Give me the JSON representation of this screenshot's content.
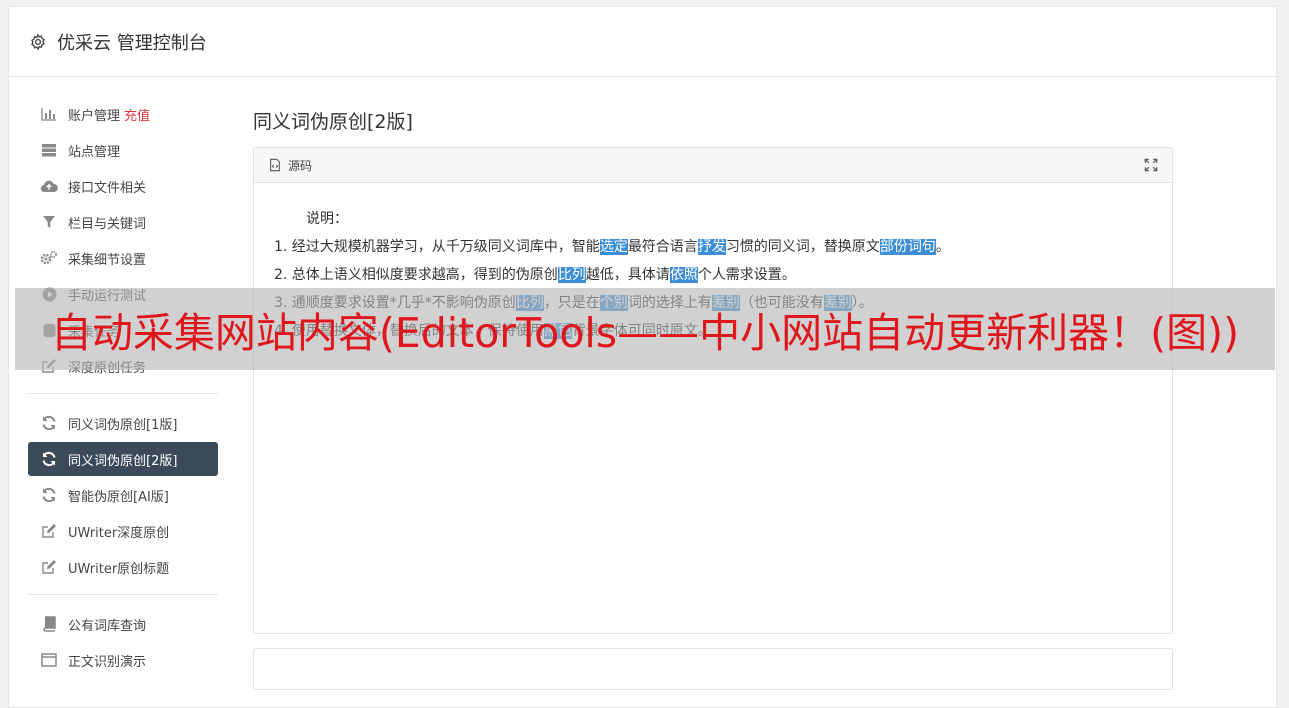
{
  "header": {
    "title": "优采云 管理控制台",
    "icon": "gear-icon"
  },
  "sidebar": {
    "group1": [
      {
        "label": "账户管理",
        "extra": "充值",
        "icon": "bar-chart-icon"
      },
      {
        "label": "站点管理",
        "icon": "server-icon"
      },
      {
        "label": "接口文件相关",
        "icon": "cloud-upload-icon"
      },
      {
        "label": "栏目与关键词",
        "icon": "filter-icon"
      },
      {
        "label": "采集细节设置",
        "icon": "cogs-icon"
      },
      {
        "label": "手动运行测试",
        "icon": "play-circle-icon"
      },
      {
        "label": "采集任务",
        "icon": "database-icon"
      },
      {
        "label": "深度原创任务",
        "icon": "edit-icon"
      }
    ],
    "group2": [
      {
        "label": "同义词伪原创[1版]",
        "icon": "refresh-icon"
      },
      {
        "label": "同义词伪原创[2版]",
        "icon": "refresh-icon",
        "active": true
      },
      {
        "label": "智能伪原创[AI版]",
        "icon": "refresh-icon"
      },
      {
        "label": "UWriter深度原创",
        "icon": "edit-icon"
      },
      {
        "label": "UWriter原创标题",
        "icon": "edit-icon"
      }
    ],
    "group3": [
      {
        "label": "公有词库查询",
        "icon": "book-icon"
      },
      {
        "label": "正文识别演示",
        "icon": "window-icon"
      }
    ]
  },
  "main": {
    "title": "同义词伪原创[2版]",
    "toolbar": {
      "source_label": "源码"
    },
    "content": {
      "heading": "说明：",
      "lines": [
        [
          "1. 经过大规模机器学习，从千万级同义词库中，智能",
          {
            "h": "选定"
          },
          "最符合语言",
          {
            "h": "抒发"
          },
          "习惯的同义词，替换原文",
          {
            "h": "部份"
          },
          {
            "h": "词句"
          },
          "。"
        ],
        [
          "2. 总体上语义相似度要求越高，得到的伪原创",
          {
            "h": "比列"
          },
          "越低，具体请",
          {
            "h": "依照"
          },
          "个人需求设置。"
        ],
        [
          "3. 通顺度要求设置*几乎*不影响伪原创",
          {
            "h": "比列"
          },
          "，只是在",
          {
            "h": "个别"
          },
          "词的选择上有",
          {
            "h": "差别"
          },
          "（也可能没有",
          {
            "h": "差别"
          },
          "）。"
        ],
        [
          "4. 使用替换文体，替换后的文本，保持使用",
          {
            "h": "黑色"
          },
          "背景字体可同时原文。"
        ]
      ]
    }
  },
  "overlay": {
    "text": "自动采集网站内容(EditorTools——中小网站自动更新利器！(图))"
  },
  "colors": {
    "active_nav_bg": "#3b4a5a",
    "highlight": "#3d8ed8",
    "overlay_text": "#e0161d",
    "charge": "#d9343a"
  }
}
